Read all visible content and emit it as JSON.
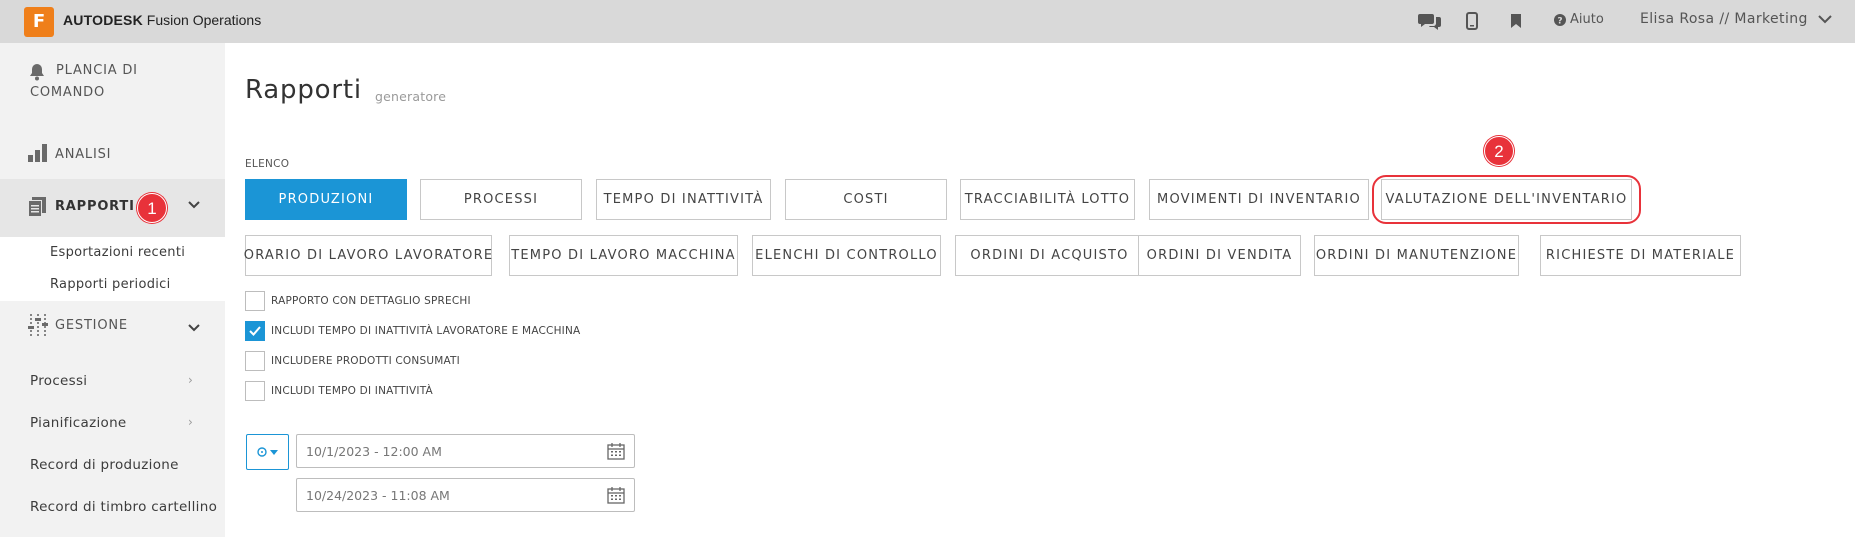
{
  "header": {
    "logo_letter": "F",
    "brand_bold": "AUTODESK",
    "brand_rest": " Fusion Operations",
    "help_label": "Aiuto",
    "user_label": "Elisa Rosa // Marketing",
    "icons": [
      "chat-icon",
      "mobile-icon",
      "bookmark-icon",
      "help-icon",
      "chevron-down-icon"
    ]
  },
  "sidebar": {
    "dashboard": "PLANCIA DI COMANDO",
    "dashboard_line1": "PLANCIA DI",
    "dashboard_line2": "COMANDO",
    "analysis": "ANALISI",
    "reports": "RAPPORTI",
    "reports_sub": [
      "Esportazioni recenti",
      "Rapporti periodici"
    ],
    "management": "GESTIONE",
    "links": [
      "Processi",
      "Pianificazione",
      "Record di produzione",
      "Record di timbro cartellino"
    ]
  },
  "page": {
    "title": "Rapporti",
    "subtitle": "generatore",
    "list_label": "ELENCO"
  },
  "buttons_row1": [
    "PRODUZIONI",
    "PROCESSI",
    "TEMPO DI INATTIVITÀ",
    "COSTI",
    "TRACCIABILITÀ LOTTO",
    "MOVIMENTI DI INVENTARIO",
    "VALUTAZIONE DELL'INVENTARIO"
  ],
  "buttons_row2": [
    "ORARIO DI LAVORO LAVORATORE",
    "TEMPO DI LAVORO MACCHINA",
    "ELENCHI DI CONTROLLO",
    "ORDINI DI ACQUISTO",
    "ORDINI DI VENDITA",
    "ORDINI DI MANUTENZIONE",
    "RICHIESTE DI MATERIALE"
  ],
  "selected_button": "PRODUZIONI",
  "checkboxes": [
    {
      "label": "RAPPORTO CON DETTAGLIO SPRECHI",
      "checked": false
    },
    {
      "label": "INCLUDI TEMPO DI INATTIVITÀ LAVORATORE E MACCHINA",
      "checked": true
    },
    {
      "label": "INCLUDERE PRODOTTI CONSUMATI",
      "checked": false
    },
    {
      "label": "INCLUDI TEMPO DI INATTIVITÀ",
      "checked": false
    }
  ],
  "dates": {
    "start": "10/1/2023 - 12:00 AM",
    "end": "10/24/2023 - 11:08 AM"
  },
  "callouts": {
    "one": "1",
    "two": "2"
  },
  "colors": {
    "accent": "#1b95d6",
    "brand_orange": "#ef7f1a",
    "callout_red": "#e8323a"
  }
}
